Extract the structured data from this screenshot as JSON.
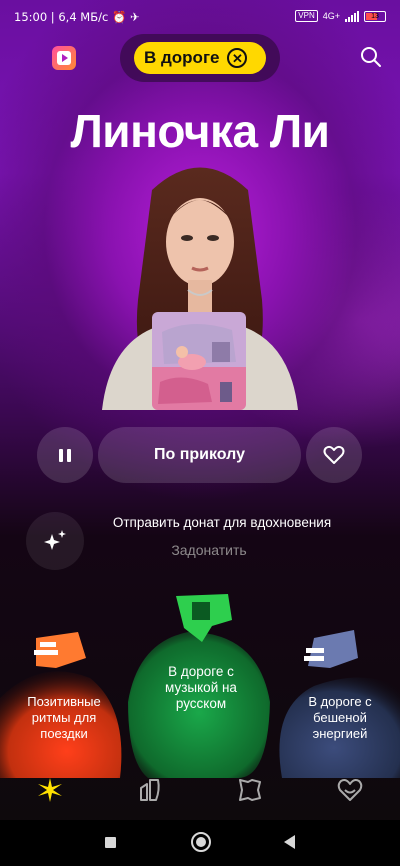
{
  "status_bar": {
    "time": "15:00",
    "network_speed": "6,4 МБ/с",
    "vpn": "VPN",
    "network_type": "4G+",
    "battery": "13"
  },
  "header": {
    "mode_chip_label": "В дороге",
    "icons": [
      "yandex-music-logo-icon",
      "close-icon",
      "search-icon"
    ]
  },
  "artist": {
    "name": "Линочка Ли"
  },
  "player": {
    "track_title": "По приколу",
    "state": "playing"
  },
  "donation": {
    "text": "Отправить донат для вдохновения",
    "link_label": "Задонатить"
  },
  "vibes": [
    {
      "label": "Позитивные ритмы для поездки",
      "color": "#ff5a1f"
    },
    {
      "label": "В дороге с музыкой на русском",
      "color": "#1fa04a"
    },
    {
      "label": "В дороге с бешеной энергией",
      "color": "#3a4a78"
    }
  ],
  "bottom_nav": [
    "sparkle-home-icon",
    "collection-icon",
    "podcasts-icon",
    "favorites-icon"
  ],
  "colors": {
    "accent_yellow": "#ffd800",
    "purple": "#8a12b0",
    "dark": "#0d0a0b"
  }
}
